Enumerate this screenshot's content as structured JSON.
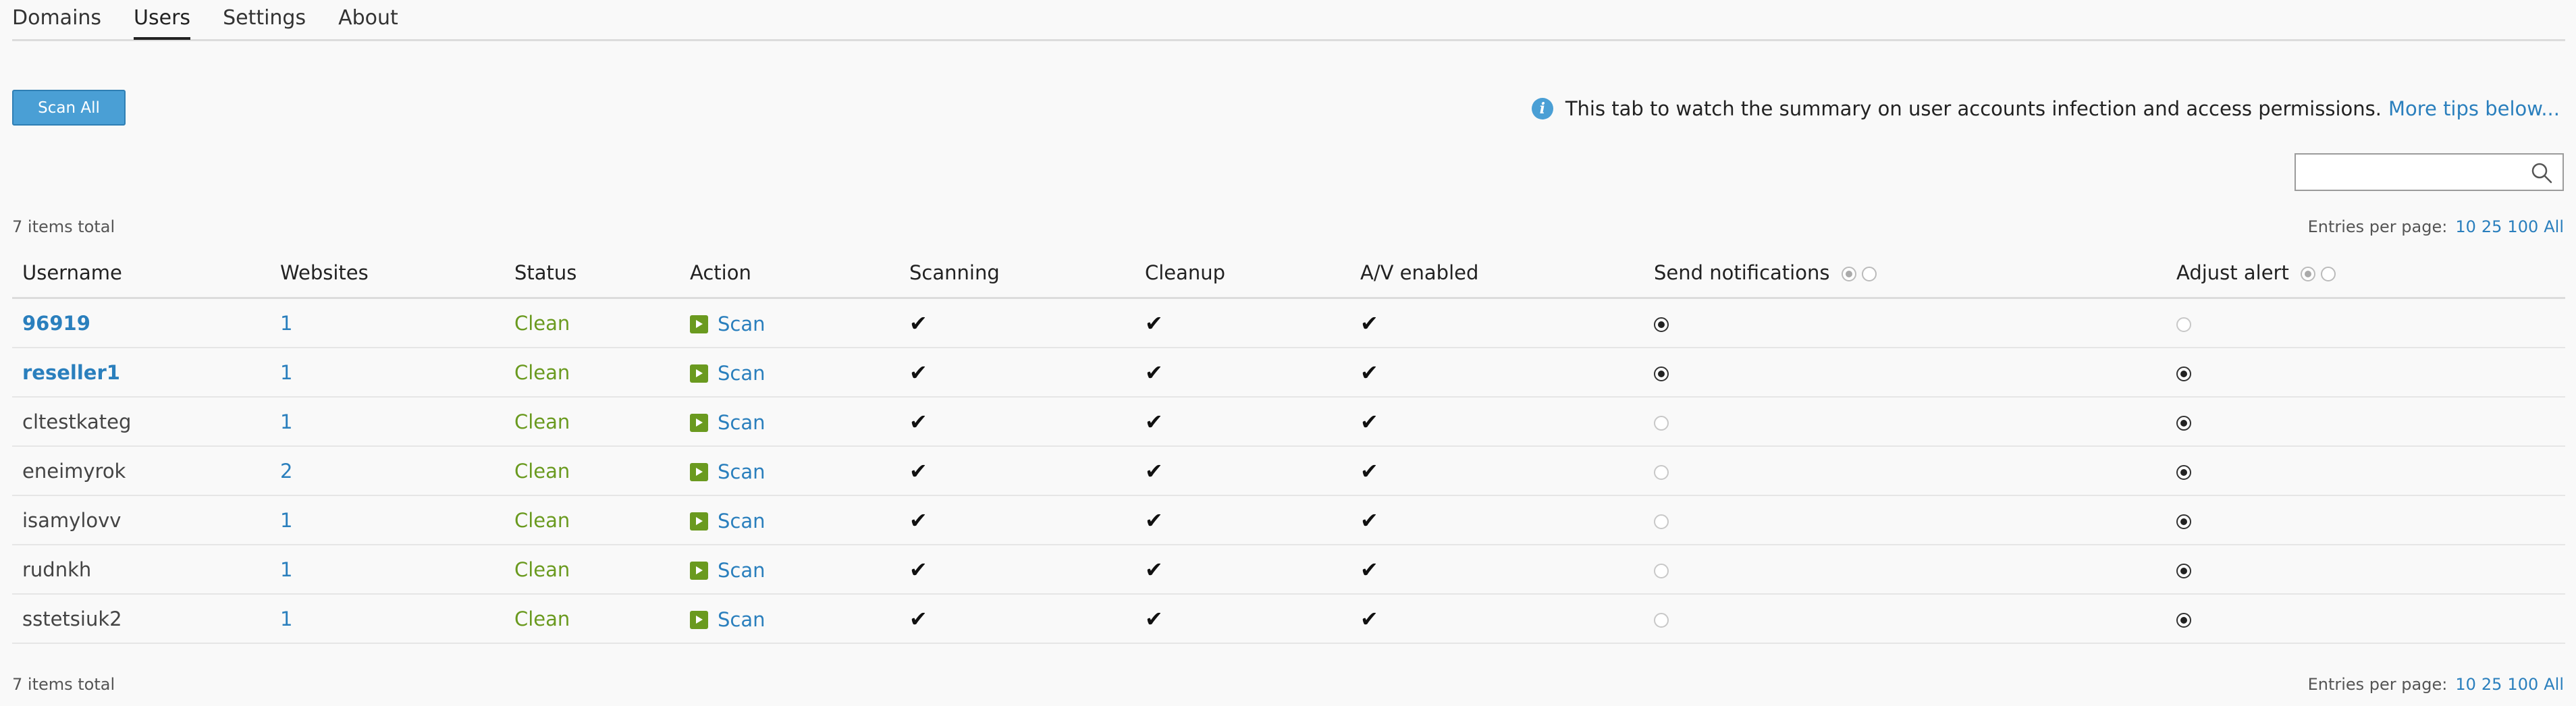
{
  "tabs": [
    {
      "label": "Domains",
      "active": false
    },
    {
      "label": "Users",
      "active": true
    },
    {
      "label": "Settings",
      "active": false
    },
    {
      "label": "About",
      "active": false
    }
  ],
  "toolbar": {
    "scan_all_label": "Scan All"
  },
  "info": {
    "icon": "info-icon",
    "text": "This tab to watch the summary on user accounts infection and access permissions.",
    "link": "More tips below..."
  },
  "search": {
    "value": "",
    "placeholder": "",
    "icon": "search-icon"
  },
  "summary": {
    "total_top": "7 items total",
    "total_bottom": "7 items total",
    "entries_label": "Entries per page:",
    "entries_options": [
      "10",
      "25",
      "100",
      "All"
    ]
  },
  "table": {
    "columns": [
      "Username",
      "Websites",
      "Status",
      "Action",
      "Scanning",
      "Cleanup",
      "A/V enabled",
      "Send notifications",
      "Adjust alert"
    ],
    "rows": [
      {
        "username": "96919",
        "user_link": true,
        "websites": "1",
        "status": "Clean",
        "action": "Scan",
        "scanning": "✔",
        "cleanup": "✔",
        "av": "✔",
        "notify": true,
        "alert": false
      },
      {
        "username": "reseller1",
        "user_link": true,
        "websites": "1",
        "status": "Clean",
        "action": "Scan",
        "scanning": "✔",
        "cleanup": "✔",
        "av": "✔",
        "notify": true,
        "alert": true
      },
      {
        "username": "cltestkateg",
        "user_link": false,
        "websites": "1",
        "status": "Clean",
        "action": "Scan",
        "scanning": "✔",
        "cleanup": "✔",
        "av": "✔",
        "notify": false,
        "alert": true
      },
      {
        "username": "eneimyrok",
        "user_link": false,
        "websites": "2",
        "status": "Clean",
        "action": "Scan",
        "scanning": "✔",
        "cleanup": "✔",
        "av": "✔",
        "notify": false,
        "alert": true
      },
      {
        "username": "isamylovv",
        "user_link": false,
        "websites": "1",
        "status": "Clean",
        "action": "Scan",
        "scanning": "✔",
        "cleanup": "✔",
        "av": "✔",
        "notify": false,
        "alert": true
      },
      {
        "username": "rudnkh",
        "user_link": false,
        "websites": "1",
        "status": "Clean",
        "action": "Scan",
        "scanning": "✔",
        "cleanup": "✔",
        "av": "✔",
        "notify": false,
        "alert": true
      },
      {
        "username": "sstetsiuk2",
        "user_link": false,
        "websites": "1",
        "status": "Clean",
        "action": "Scan",
        "scanning": "✔",
        "cleanup": "✔",
        "av": "✔",
        "notify": false,
        "alert": true
      }
    ]
  },
  "colors": {
    "accent": "#4a9fd5",
    "link": "#2a7fbd",
    "clean": "#6a9a1f"
  }
}
